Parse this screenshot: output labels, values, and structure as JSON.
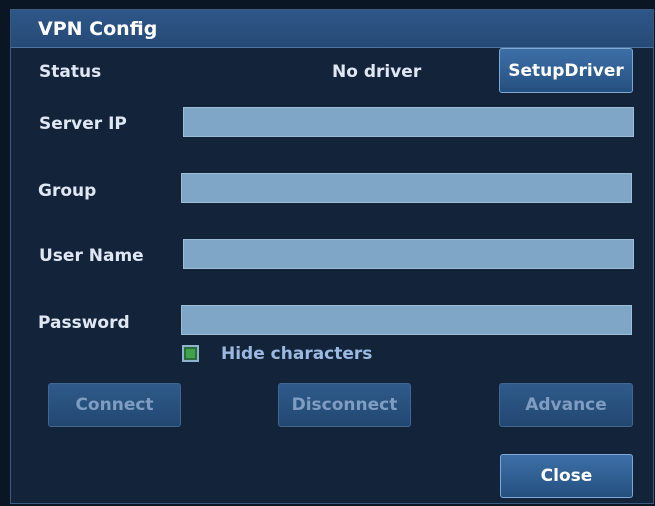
{
  "dialog": {
    "title": "VPN Config",
    "status_label": "Status",
    "status_value": "No driver",
    "setup_driver_button": "SetupDriver",
    "fields": {
      "server_ip_label": "Server IP",
      "server_ip_value": "",
      "group_label": "Group",
      "group_value": "",
      "user_name_label": "User Name",
      "user_name_value": "",
      "password_label": "Password",
      "password_value": ""
    },
    "hide_characters": {
      "label": "Hide characters",
      "checked": true
    },
    "buttons": {
      "connect": "Connect",
      "disconnect": "Disconnect",
      "advance": "Advance",
      "close": "Close"
    }
  },
  "colors": {
    "dialog_background": "#13233a",
    "title_bar": "#2e5687",
    "input_field": "#7fa6c6",
    "checkbox_checked": "#3fa34d"
  }
}
